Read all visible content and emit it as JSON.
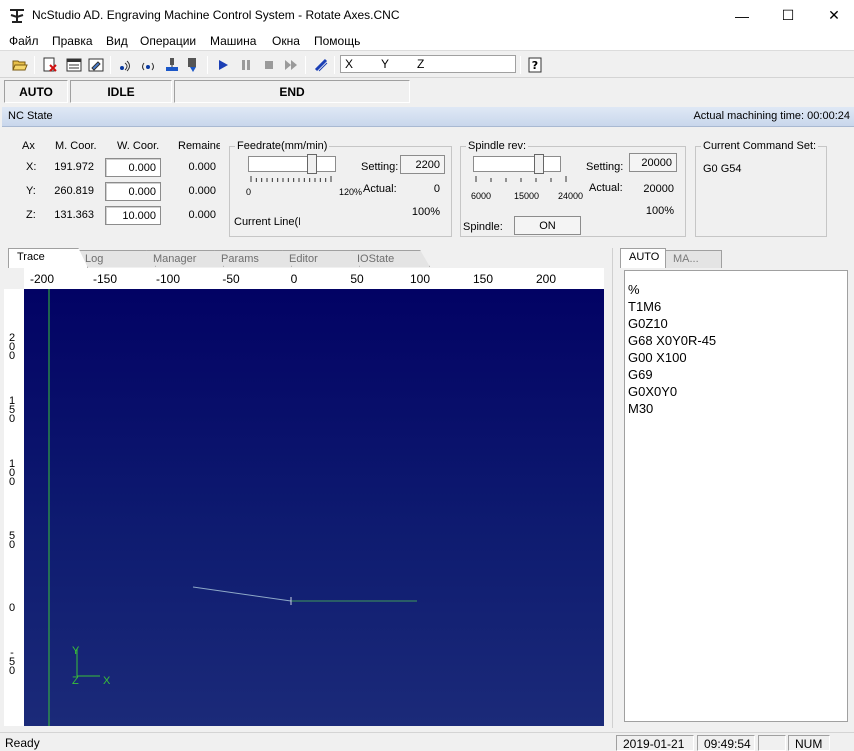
{
  "window": {
    "title": "NcStudio AD. Engraving Machine Control System  - Rotate Axes.CNC",
    "minimize_glyph": "—",
    "maximize_glyph": "☐",
    "close_glyph": "✕"
  },
  "menu": [
    "Файл",
    "Правка",
    "Вид",
    "Операции",
    "Машина",
    "Окна",
    "Помощь"
  ],
  "toolbar": {
    "axes": [
      "X",
      "Y",
      "Z"
    ],
    "icons": [
      "open-folder-icon",
      "delete-doc-icon",
      "window-icon",
      "edit-doc-icon",
      "signal-left-icon",
      "signal-both-icon",
      "workpiece-icon",
      "jog-icon",
      "start-icon",
      "pause-icon",
      "stop-icon",
      "step-icon",
      "simulate-icon",
      "help-icon"
    ]
  },
  "status": {
    "mode": "AUTO",
    "state": "IDLE",
    "program": "END"
  },
  "nc": {
    "label": "NC State",
    "machining_time_label": "Actual machining time:",
    "machining_time": "00:00:24"
  },
  "coords": {
    "headers": {
      "axis": "Ax",
      "machine": "M. Coor.",
      "work": "W. Coor.",
      "remain": "Remaine"
    },
    "rows": [
      {
        "axis": "X:",
        "machine": "191.972",
        "work": "0.000",
        "remain": "0.000"
      },
      {
        "axis": "Y:",
        "machine": "260.819",
        "work": "0.000",
        "remain": "0.000"
      },
      {
        "axis": "Z:",
        "machine": "131.363",
        "work": "10.000",
        "remain": "0.000"
      }
    ]
  },
  "feedrate": {
    "title": "Feedrate(mm/min)",
    "setting_label": "Setting:",
    "setting": "2200",
    "actual_label": "Actual:",
    "actual": "0",
    "percent": "100%",
    "scale_min": "0",
    "scale_max": "120%",
    "current_line": "Current Line(E",
    "slider_level": 0.75
  },
  "spindle": {
    "title": "Spindle rev:",
    "setting_label": "Setting:",
    "setting": "20000",
    "actual_label": "Actual:",
    "actual": "20000",
    "percent": "100%",
    "scale": [
      "6000",
      "15000",
      "24000"
    ],
    "switch_label": "Spindle:",
    "switch_state": "ON",
    "slider_level": 0.78
  },
  "command_set": {
    "title": "Current Command Set:",
    "value": "G0 G54"
  },
  "tabs": [
    "Trace",
    "Log",
    "Manager",
    "Params",
    "Editor",
    "IOState"
  ],
  "active_tab": "Trace",
  "trace": {
    "x_ticks": [
      "-200",
      "-150",
      "-100",
      "-50",
      "0",
      "50",
      "100",
      "150",
      "200"
    ],
    "y_ticks": [
      "200",
      "150",
      "100",
      "50",
      "0",
      "-50"
    ],
    "axis_labels": {
      "x": "X",
      "y": "Y",
      "z": "Z"
    }
  },
  "right_tabs": [
    "AUTO",
    "MA..."
  ],
  "gcode": [
    "%",
    "T1M6",
    "G0Z10",
    "G68 X0Y0R-45",
    "G00 X100",
    "G69",
    "G0X0Y0",
    "M30"
  ],
  "statusbar": {
    "text": "Ready",
    "date": "2019-01-21",
    "time": "09:49:54",
    "num": "NUM"
  }
}
